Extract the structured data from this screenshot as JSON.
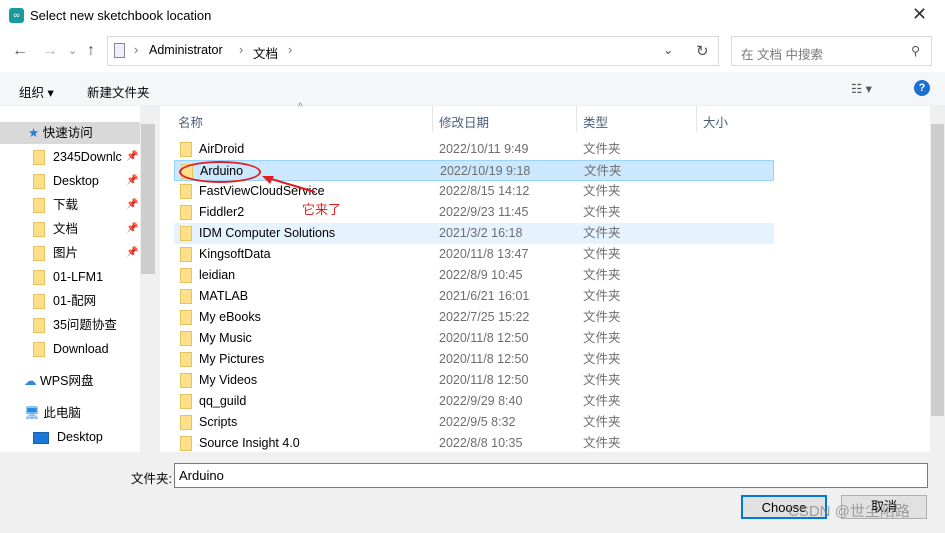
{
  "window": {
    "title": "Select new sketchbook location",
    "close": "✕"
  },
  "nav": {
    "back": "←",
    "forward": "→",
    "recent": "⌄",
    "up": "↑",
    "breadcrumb": [
      "Administrator",
      "文档"
    ],
    "sep": "›",
    "dropdown": "⌄",
    "refresh": "↻",
    "search_placeholder": "在 文档 中搜索"
  },
  "toolbar": {
    "organize": "组织 ▾",
    "new_folder": "新建文件夹",
    "view": "☷ ▾",
    "help": "?"
  },
  "sidebar": {
    "quick_access": "快速访问",
    "items": [
      {
        "label": "2345Downlc",
        "icon": "folder-icon",
        "pinned": true
      },
      {
        "label": "Desktop",
        "icon": "desktop-icon",
        "pinned": true
      },
      {
        "label": "下载",
        "icon": "download-icon",
        "pinned": true
      },
      {
        "label": "文档",
        "icon": "document-icon",
        "pinned": true
      },
      {
        "label": "图片",
        "icon": "pictures-icon",
        "pinned": true
      },
      {
        "label": "01-LFM1",
        "icon": "folder-icon"
      },
      {
        "label": "01-配网",
        "icon": "folder-icon"
      },
      {
        "label": "35问题协查",
        "icon": "folder-icon"
      },
      {
        "label": "Download",
        "icon": "folder-icon"
      }
    ],
    "wps": "WPS网盘",
    "pc": "此电脑",
    "pc_desktop": "Desktop"
  },
  "columns": [
    "名称",
    "修改日期",
    "类型",
    "大小"
  ],
  "files": [
    {
      "name": "AirDroid",
      "date": "2022/10/11 9:49",
      "type": "文件夹"
    },
    {
      "name": "Arduino",
      "date": "2022/10/19 9:18",
      "type": "文件夹",
      "selected": true
    },
    {
      "name": "FastViewCloudService",
      "date": "2022/8/15 14:12",
      "type": "文件夹"
    },
    {
      "name": "Fiddler2",
      "date": "2022/9/23 11:45",
      "type": "文件夹"
    },
    {
      "name": "IDM Computer Solutions",
      "date": "2021/3/2 16:18",
      "type": "文件夹",
      "hover": true
    },
    {
      "name": "KingsoftData",
      "date": "2020/11/8 13:47",
      "type": "文件夹"
    },
    {
      "name": "leidian",
      "date": "2022/8/9 10:45",
      "type": "文件夹"
    },
    {
      "name": "MATLAB",
      "date": "2021/6/21 16:01",
      "type": "文件夹"
    },
    {
      "name": "My eBooks",
      "date": "2022/7/25 15:22",
      "type": "文件夹"
    },
    {
      "name": "My Music",
      "date": "2020/11/8 12:50",
      "type": "文件夹"
    },
    {
      "name": "My Pictures",
      "date": "2020/11/8 12:50",
      "type": "文件夹"
    },
    {
      "name": "My Videos",
      "date": "2020/11/8 12:50",
      "type": "文件夹"
    },
    {
      "name": "qq_guild",
      "date": "2022/9/29 8:40",
      "type": "文件夹"
    },
    {
      "name": "Scripts",
      "date": "2022/9/5 8:32",
      "type": "文件夹"
    },
    {
      "name": "Source Insight 4.0",
      "date": "2022/8/8 10:35",
      "type": "文件夹"
    }
  ],
  "annotation": "它来了",
  "bottom": {
    "label": "文件夹:",
    "value": "Arduino",
    "choose": "Choose",
    "cancel": "取消"
  },
  "watermark": "CSDN @世尘陌路",
  "colors": {
    "accent": "#0078d7",
    "selection": "#cce8ff",
    "annotation": "#e02020"
  }
}
